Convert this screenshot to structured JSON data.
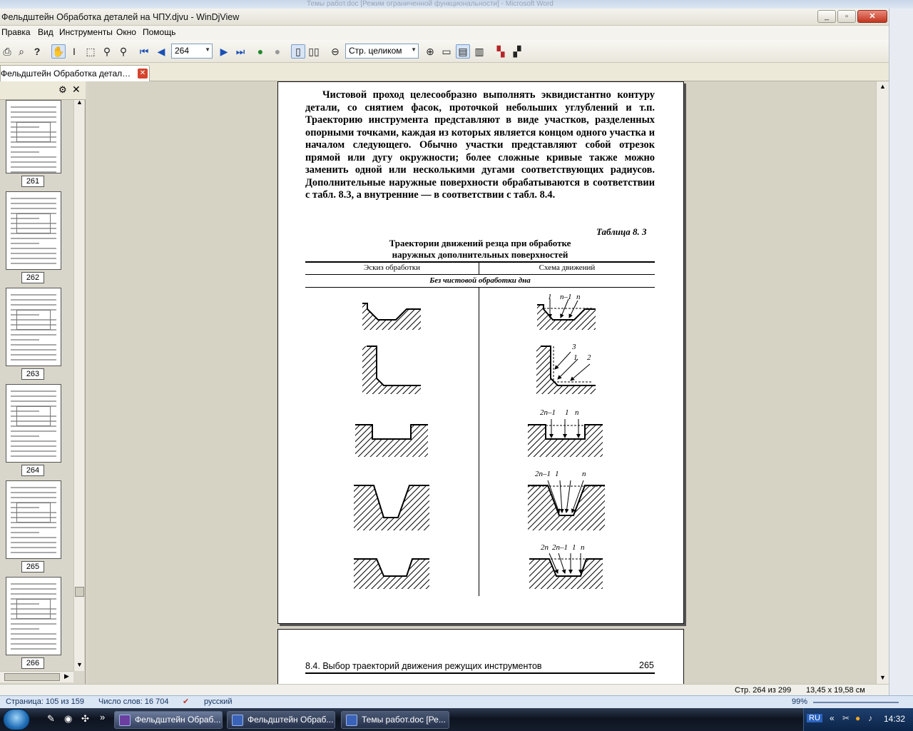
{
  "window": {
    "title": "Фельдштейн Обработка деталей на ЧПУ.djvu - WinDjView",
    "behind_title": "Темы работ.doc [Режим ограниченной функциональности] - Microsoft Word"
  },
  "menu": [
    "Правка",
    "Вид",
    "Инструменты",
    "Окно",
    "Помощь"
  ],
  "toolbar": {
    "page_value": "264",
    "zoom_value": "Стр. целиком"
  },
  "tab": {
    "label": "Фельдштейн Обработка деталей на ЧПУ.djvu"
  },
  "thumbnails": [
    {
      "page": "261"
    },
    {
      "page": "262"
    },
    {
      "page": "263"
    },
    {
      "page": "264"
    },
    {
      "page": "265"
    },
    {
      "page": "266"
    }
  ],
  "page": {
    "paragraph": "Чистовой проход целесообразно выполнять эквидистантно контуру детали, со снятием фасок, проточкой небольших углублений и т.п. Траекторию инструмента представляют в виде участков, разделенных опорными точками, каждая из которых является концом одного участка и началом следующего. Обычно участки представляют собой отрезок прямой или дугу окружности; более сложные кривые также можно заменить одной или несколькими дугами соответствующих радиусов. Дополнительные наружные поверхности обрабатываются в соответствии с табл. 8.3, а внутренние — в соответствии с табл. 8.4.",
    "table_label": "Таблица 8. 3",
    "table_title_1": "Траектории движений резца при обработке",
    "table_title_2": "наружных дополнительных поверхностей",
    "col_left": "Эскиз обработки",
    "col_right": "Схема движений",
    "subheader": "Без чистовой обработки дна",
    "labels": {
      "r1": [
        "1",
        "n–1",
        "n"
      ],
      "r2": [
        "3",
        "1",
        "2"
      ],
      "r3": [
        "2n–1",
        "1",
        "n"
      ],
      "r4": [
        "2n–1",
        "1",
        "n"
      ],
      "r5": [
        "2n",
        "2n–1",
        "1",
        "n"
      ]
    }
  },
  "page2": {
    "header": "8.4. Выбор траекторий движения режущих инструментов",
    "number": "265"
  },
  "status": {
    "page_of": "Стр. 264 из 299",
    "size": "13,45 x 19,58 см"
  },
  "word_status": {
    "page": "Страница: 105 из 159",
    "words": "Число слов: 16 704",
    "lang": "русский",
    "zoom": "99%"
  },
  "taskbar": {
    "tasks": [
      "Фельдштейн Обраб...",
      "Фельдштейн Обраб...",
      "Темы работ.doc [Ре..."
    ],
    "lang": "RU",
    "clock": "14:32"
  }
}
